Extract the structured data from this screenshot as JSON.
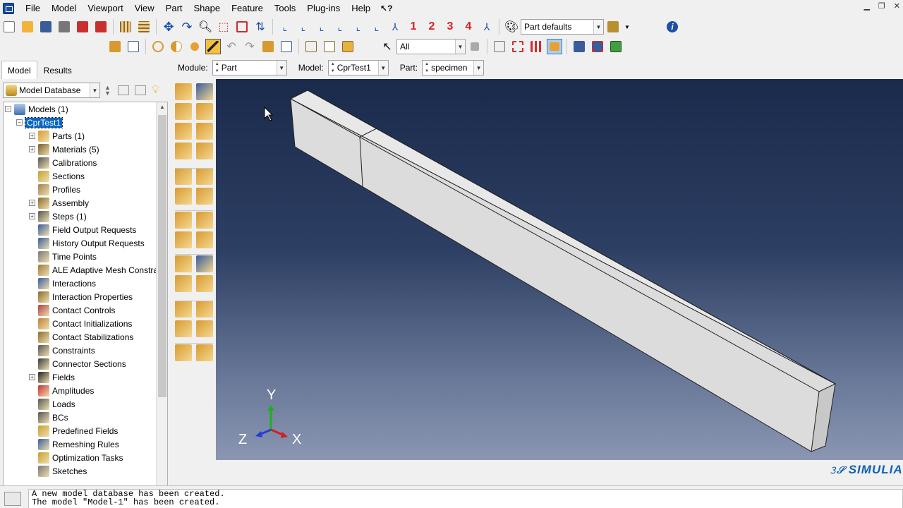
{
  "menu": [
    "File",
    "Model",
    "Viewport",
    "View",
    "Part",
    "Shape",
    "Feature",
    "Tools",
    "Plug-ins",
    "Help"
  ],
  "menu_help_pointer": "?",
  "toolbar": {
    "view_numbers": [
      "1",
      "2",
      "3",
      "4"
    ],
    "render_style": "Part defaults",
    "selection_filter": "All"
  },
  "module_bar": {
    "module_label": "Module:",
    "module_value": "Part",
    "model_label": "Model:",
    "model_value": "CprTest1",
    "part_label": "Part:",
    "part_value": "specimen"
  },
  "tabs": [
    "Model",
    "Results"
  ],
  "database": "Model Database",
  "tree": {
    "root": "Models (1)",
    "model": "CprTest1",
    "items": [
      "Parts (1)",
      "Materials (5)",
      "Calibrations",
      "Sections",
      "Profiles",
      "Assembly",
      "Steps (1)",
      "Field Output Requests",
      "History Output Requests",
      "Time Points",
      "ALE Adaptive Mesh Constra",
      "Interactions",
      "Interaction Properties",
      "Contact Controls",
      "Contact Initializations",
      "Contact Stabilizations",
      "Constraints",
      "Connector Sections",
      "Fields",
      "Amplitudes",
      "Loads",
      "BCs",
      "Predefined Fields",
      "Remeshing Rules",
      "Optimization Tasks",
      "Sketches"
    ],
    "expandable": [
      "Parts (1)",
      "Materials (5)",
      "Assembly",
      "Steps (1)",
      "Fields"
    ]
  },
  "triad": {
    "y": "Y",
    "z": "Z",
    "x": "X"
  },
  "brand": "SIMULIA",
  "messages": [
    "A new model database has been created.",
    "The model \"Model-1\" has been created."
  ],
  "colors": {
    "viewport_top": "#1a2a4b",
    "viewport_bottom": "#8a96b2",
    "part_face": "#dcdcdc",
    "selected": "#0a66c2",
    "brand": "#1060b0"
  }
}
